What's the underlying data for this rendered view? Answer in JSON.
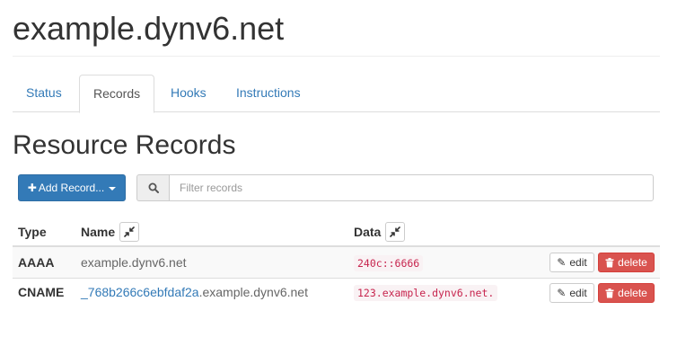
{
  "page": {
    "title": "example.dynv6.net"
  },
  "tabs": [
    {
      "label": "Status"
    },
    {
      "label": "Records"
    },
    {
      "label": "Hooks"
    },
    {
      "label": "Instructions"
    }
  ],
  "active_tab": "Records",
  "section": {
    "title": "Resource Records",
    "add_button_label": "Add Record...",
    "filter_placeholder": "Filter records"
  },
  "table": {
    "headers": {
      "type": "Type",
      "name": "Name",
      "data": "Data"
    },
    "rows": [
      {
        "type": "AAAA",
        "name_prefix": "",
        "name_suffix": "example.dynv6.net",
        "data": "240c::6666",
        "edit_label": "edit",
        "delete_label": "delete"
      },
      {
        "type": "CNAME",
        "name_prefix": "_768b266c6ebfdaf2a",
        "name_suffix": ".example.dynv6.net",
        "data": "123.example.dynv6.net.",
        "edit_label": "edit",
        "delete_label": "delete"
      }
    ]
  },
  "colors": {
    "primary": "#337ab7",
    "danger": "#d9534f",
    "code_text": "#c7254e",
    "code_bg": "#f9f2f4"
  },
  "icons": {
    "add": "plus-icon",
    "dropdown": "caret-down-icon",
    "search": "search-icon",
    "sort": "compress-icon",
    "edit": "pencil-icon",
    "delete": "trash-icon"
  }
}
